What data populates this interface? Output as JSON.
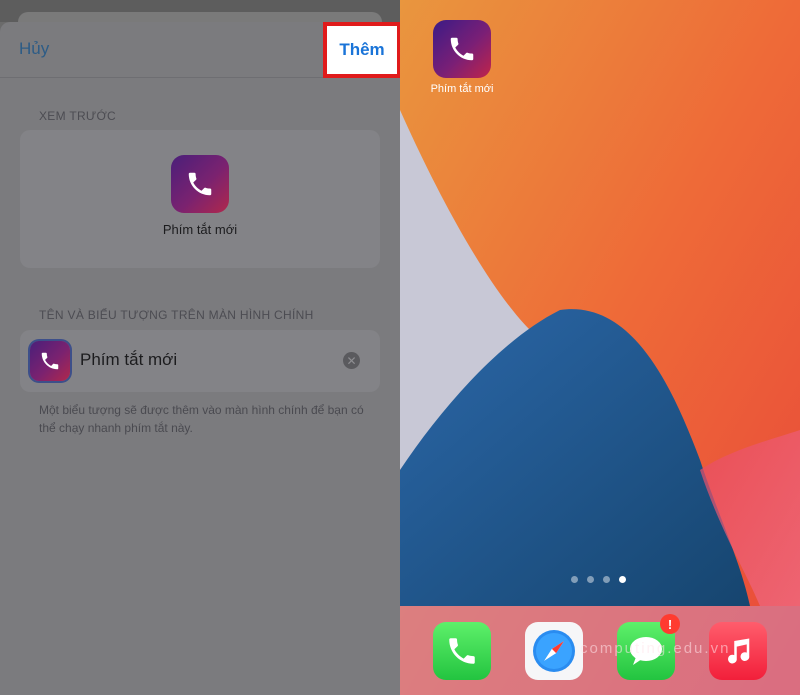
{
  "sheet": {
    "cancel_label": "Hủy",
    "add_label": "Thêm",
    "preview_section_label": "XEM TRƯỚC",
    "preview_name": "Phím tắt mới",
    "home_section_label": "TÊN VÀ BIỂU TƯỢNG TRÊN MÀN HÌNH CHÍNH",
    "name_value": "Phím tắt mới",
    "footnote": "Một biểu tượng sẽ được thêm vào màn hình chính để bạn có thể chạy nhanh phím tắt này.",
    "highlight_color": "#e01b1b"
  },
  "home": {
    "shortcut_label": "Phím tắt mới",
    "page_dots": 4,
    "active_page": 4,
    "dock_apps": [
      "phone-icon",
      "safari-icon",
      "messages-icon",
      "music-icon"
    ],
    "messages_badge": "!",
    "watermark": "computing.edu.vn"
  }
}
